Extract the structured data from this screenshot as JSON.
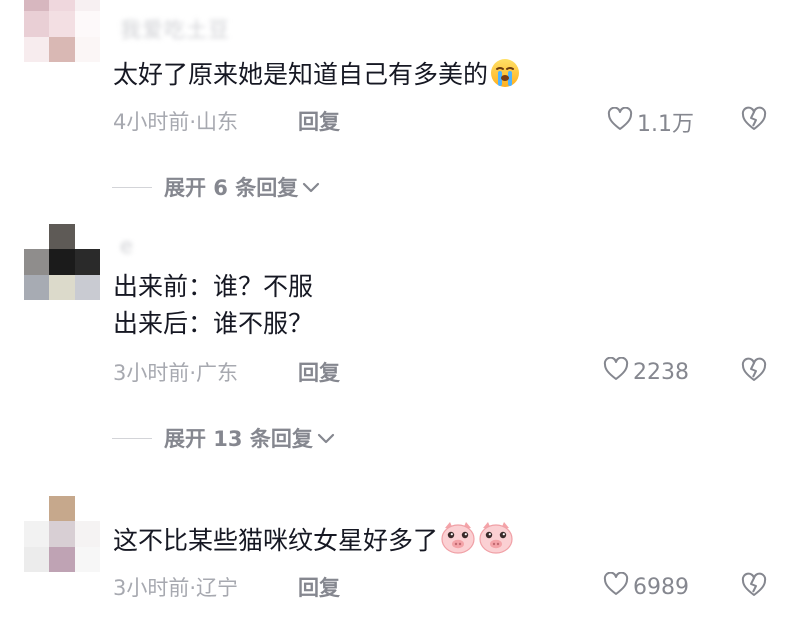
{
  "comments": [
    {
      "username": "我爱吃土豆",
      "lines": [
        "太好了原来她是知道自己有多美的"
      ],
      "emoji": [
        "crying-face-icon"
      ],
      "meta": "4小时前·山东",
      "reply_label": "回复",
      "likes": "1.1万",
      "expand_label": "展开 6 条回复"
    },
    {
      "username": "e",
      "lines": [
        "出来前：谁？不服",
        "出来后：谁不服？"
      ],
      "emoji": [],
      "meta": "3小时前·广东",
      "reply_label": "回复",
      "likes": "2238",
      "expand_label": "展开 13 条回复"
    },
    {
      "username": "",
      "lines": [
        "这不比某些猫咪纹女星好多了"
      ],
      "emoji": [
        "pig-face-icon",
        "pig-face-icon"
      ],
      "meta": "3小时前·辽宁",
      "reply_label": "回复",
      "likes": "6989"
    }
  ],
  "colors": {
    "text": "#161823",
    "meta": "#a7a9b0",
    "action": "#85878f",
    "background": "#ffffff"
  }
}
